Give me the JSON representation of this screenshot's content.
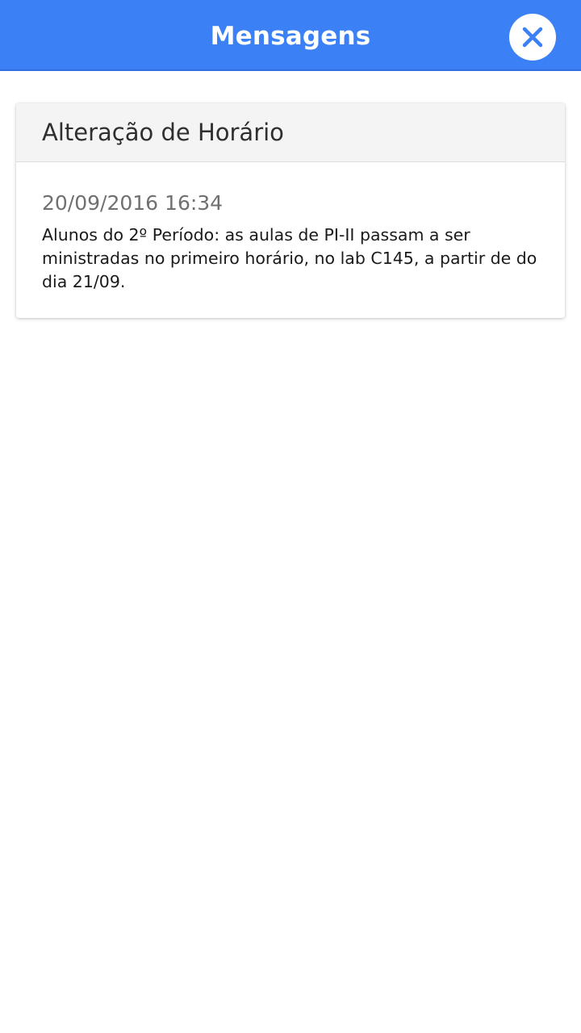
{
  "header": {
    "title": "Mensagens",
    "close_icon": "close-icon",
    "accent_color": "#3b80f5"
  },
  "messages": [
    {
      "subject": "Alteração de Horário",
      "date": "20/09/2016 16:34",
      "body": "Alunos do 2º Período: as aulas de PI-II passam a ser ministradas no primeiro horário, no lab C145, a partir de do dia 21/09."
    }
  ]
}
